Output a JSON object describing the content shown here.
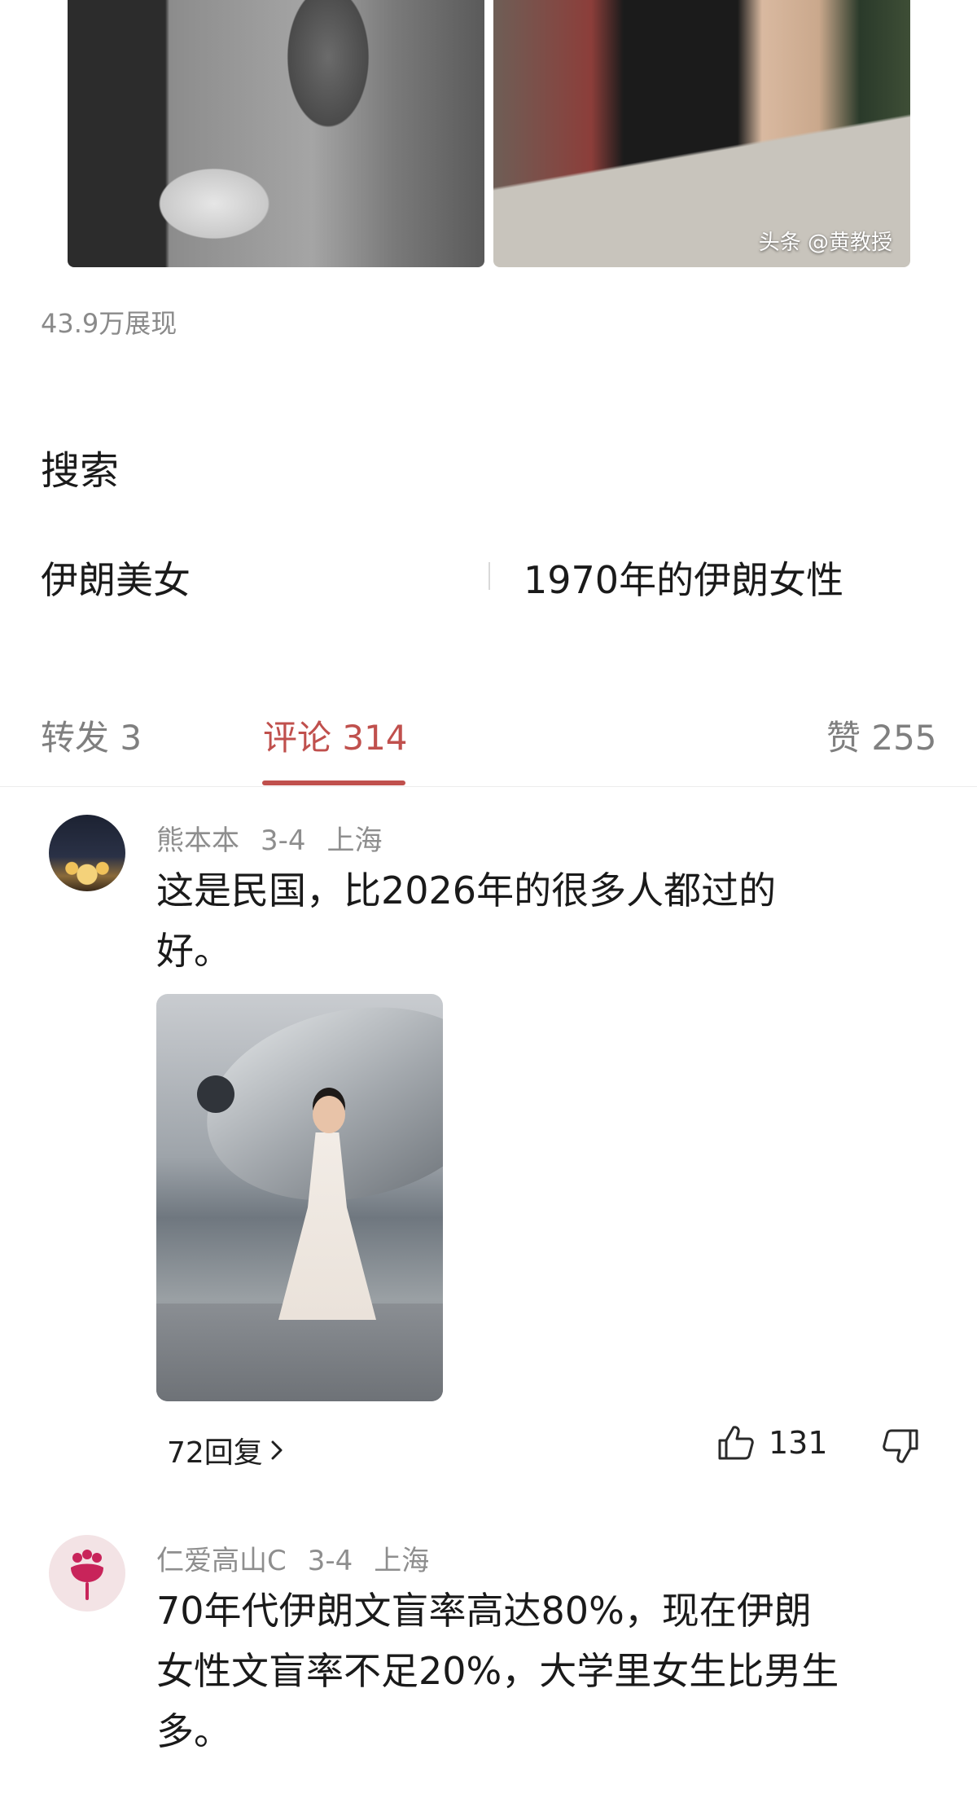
{
  "post": {
    "watermark": "头条 @黄教授",
    "views": "43.9万展现"
  },
  "search": {
    "title": "搜索",
    "terms": [
      "伊朗美女",
      "1970年的伊朗女性"
    ]
  },
  "tabs": [
    {
      "label": "转发 3",
      "active": false
    },
    {
      "label": "评论 314",
      "active": true
    },
    {
      "label": "赞 255",
      "active": false
    }
  ],
  "comments": [
    {
      "author": "熊本本",
      "date": "3-4",
      "location": "上海",
      "lines": [
        "这是民国，比2026年的很多人都过的",
        "好。"
      ],
      "replies": "72回复",
      "likes": "131"
    },
    {
      "author": "仁爱高山C",
      "date": "3-4",
      "location": "上海",
      "lines": [
        "70年代伊朗文盲率高达80%，现在伊朗",
        "女性文盲率不足20%，大学里女生比男生",
        "多。"
      ]
    }
  ],
  "icons": {
    "like": "thumbs-up-icon",
    "dislike": "thumbs-down-icon",
    "chevron": "chevron-right-icon"
  }
}
